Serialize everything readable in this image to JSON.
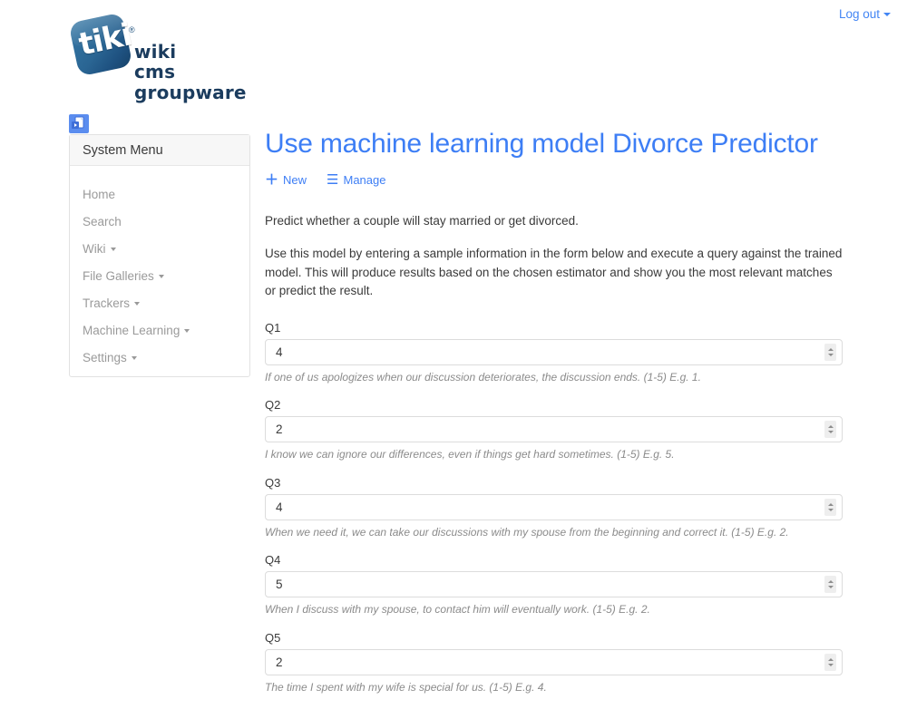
{
  "topbar": {
    "logout_label": "Log out",
    "logout_icon": "caret-down-icon"
  },
  "logo": {
    "mark_text": "tiki",
    "registered_mark": "®",
    "tagline_line1": "wiki",
    "tagline_line2": "cms",
    "tagline_line3": "groupware",
    "mark_color": "#2a6593",
    "tagline_color": "#1b3c5e"
  },
  "sidebar": {
    "toggle_icon": "page-copy-icon",
    "title": "System Menu",
    "items": [
      {
        "label": "Home",
        "has_caret": false
      },
      {
        "label": "Search",
        "has_caret": false
      },
      {
        "label": "Wiki",
        "has_caret": true
      },
      {
        "label": "File Galleries",
        "has_caret": true
      },
      {
        "label": "Trackers",
        "has_caret": true
      },
      {
        "label": "Machine Learning",
        "has_caret": true
      },
      {
        "label": "Settings",
        "has_caret": true
      }
    ]
  },
  "main": {
    "title": "Use machine learning model Divorce Predictor",
    "title_color": "#3d7ef5",
    "actions": [
      {
        "label": "New",
        "icon": "plus-icon",
        "glyph": "＋"
      },
      {
        "label": "Manage",
        "icon": "list-icon",
        "glyph": "☰"
      }
    ],
    "intro_paragraph_1": "Predict whether a couple will stay married or get divorced.",
    "intro_paragraph_2": "Use this model by entering a sample information in the form below and execute a query against the trained model. This will produce results based on the chosen estimator and show you the most relevant matches or predict the result.",
    "fields": [
      {
        "label": "Q1",
        "value": "4",
        "help": "If one of us apologizes when our discussion deteriorates, the discussion ends. (1-5) E.g. 1."
      },
      {
        "label": "Q2",
        "value": "2",
        "help": "I know we can ignore our differences, even if things get hard sometimes. (1-5) E.g. 5."
      },
      {
        "label": "Q3",
        "value": "4",
        "help": "When we need it, we can take our discussions with my spouse from the beginning and correct it. (1-5) E.g. 2."
      },
      {
        "label": "Q4",
        "value": "5",
        "help": "When I discuss with my spouse, to contact him will eventually work. (1-5) E.g. 2."
      },
      {
        "label": "Q5",
        "value": "2",
        "help": "The time I spent with my wife is special for us. (1-5) E.g. 4."
      }
    ]
  }
}
